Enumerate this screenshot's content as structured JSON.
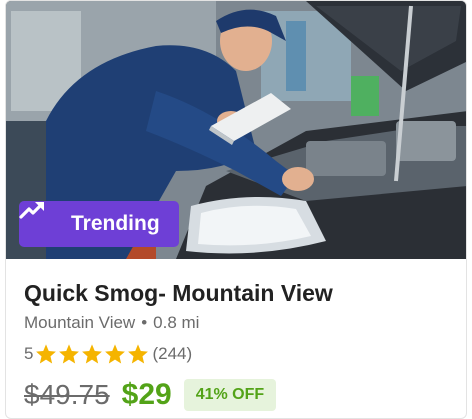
{
  "deal": {
    "badge": {
      "label": "Trending",
      "icon": "trending-up-icon"
    },
    "title": "Quick Smog- Mountain View",
    "location": "Mountain View",
    "separator": "•",
    "distance": "0.8 mi",
    "rating": {
      "value": "5",
      "stars": 5,
      "count": "(244)"
    },
    "price": {
      "original": "$49.75",
      "current": "$29",
      "discount": "41% OFF"
    }
  },
  "colors": {
    "badge_bg": "#6e3fd6",
    "star": "#f5b400",
    "price_green": "#53a318",
    "discount_bg": "#e6f3dc",
    "muted_text": "#6b6b6b"
  }
}
